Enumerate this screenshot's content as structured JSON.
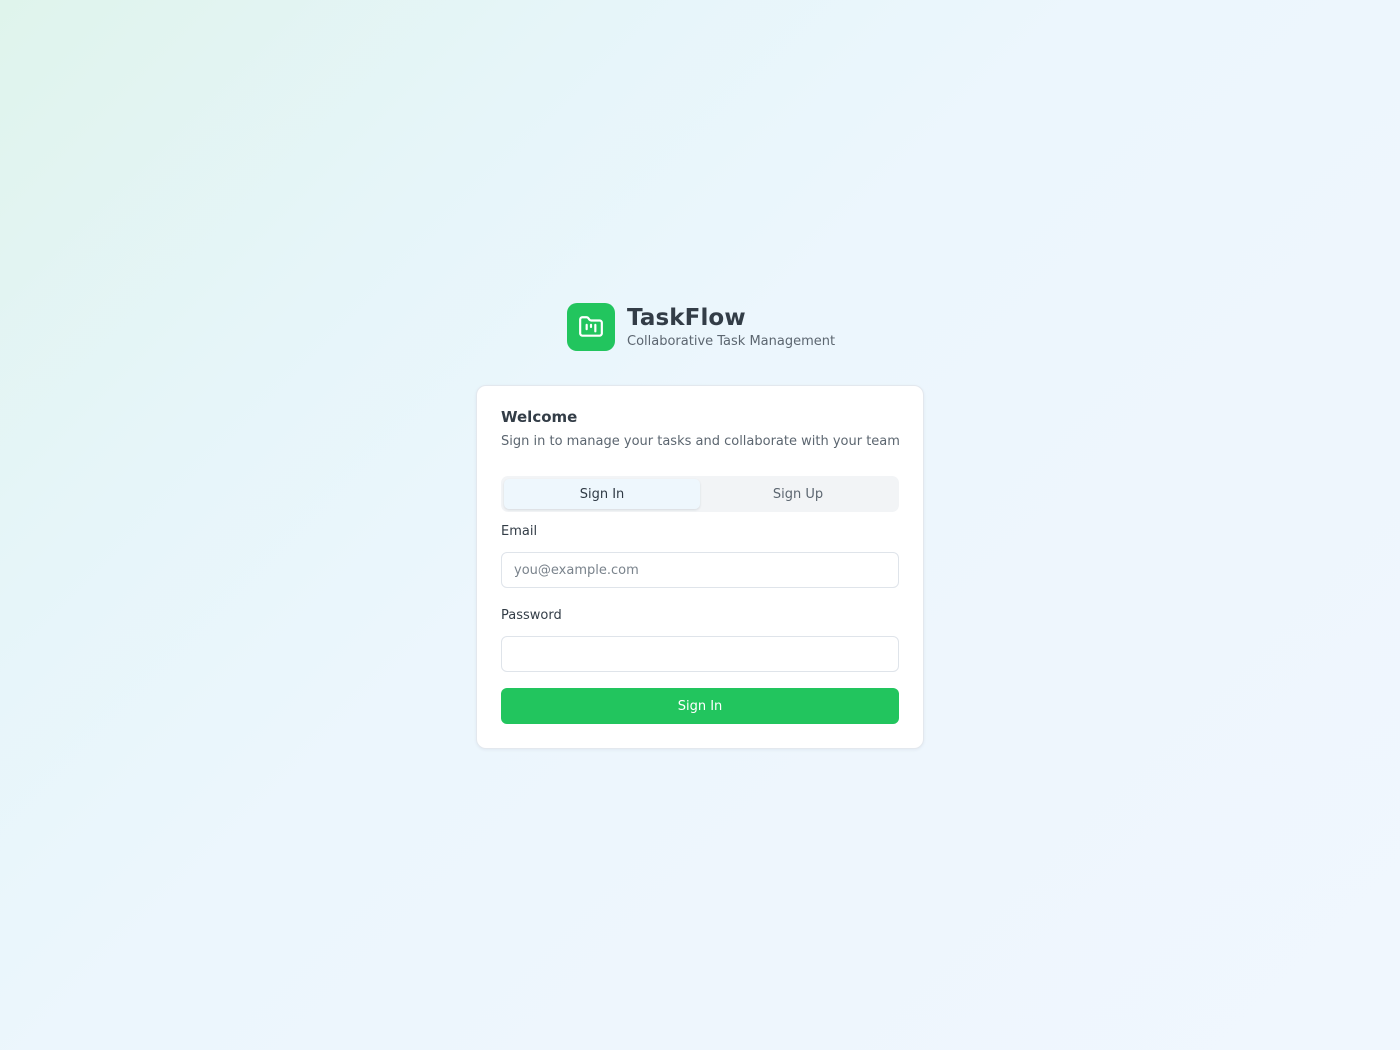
{
  "brand": {
    "title": "TaskFlow",
    "subtitle": "Collaborative Task Management",
    "logo_icon": "folder-kanban-icon",
    "accent_color": "#22c55e"
  },
  "card": {
    "title": "Welcome",
    "description": "Sign in to manage your tasks and collaborate with your team"
  },
  "tabs": [
    {
      "label": "Sign In",
      "active": true
    },
    {
      "label": "Sign Up",
      "active": false
    }
  ],
  "form": {
    "email_label": "Email",
    "email_placeholder": "you@example.com",
    "email_value": "",
    "password_label": "Password",
    "password_placeholder": "",
    "password_value": "",
    "submit_label": "Sign In"
  }
}
